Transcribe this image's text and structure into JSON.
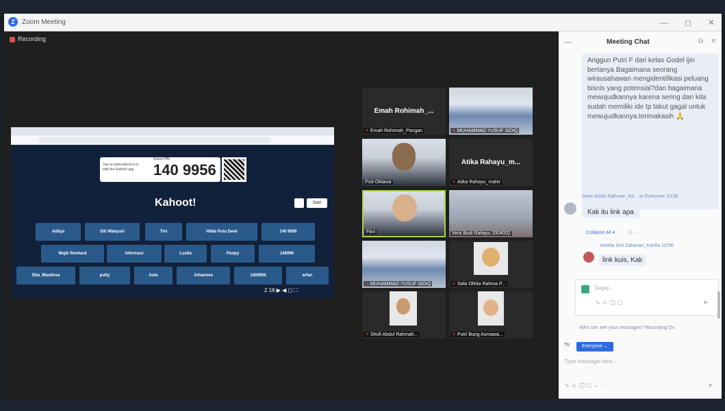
{
  "window": {
    "title": "Zoom Meeting",
    "controls": [
      "—",
      "◻",
      "✕"
    ]
  },
  "recording": {
    "label": "Recording"
  },
  "share": {
    "pin_hint": "Join at www.kahoot.it or with the Kahoot! app",
    "game_pin_label": "Game PIN:",
    "pin": "140 9956",
    "title": "Kahoot!",
    "start": "Start",
    "players": [
      "Aditya",
      "Siti Wahyuni",
      "Tini",
      "Hilda Putu Dewi",
      "140 9956",
      "Majik Renhard",
      "informasi",
      "Lusita",
      "Poopy",
      "140996",
      "Dita_Maulinsa",
      "putty",
      "Aulu",
      "Johannes",
      "1409956",
      "arfan"
    ],
    "controls": "2 16  ▶  ◀ ◻ ⛶"
  },
  "participants": [
    {
      "name": "Emah Rohimah_Pangan",
      "big": "Emah Rohimah_...",
      "type": "text"
    },
    {
      "name": "MUHAMMAD YUSUF SIDIQ",
      "type": "classroom"
    },
    {
      "name": "Fisti Oktavia",
      "type": "person"
    },
    {
      "name": "Atika Rahayu_mahir",
      "big": "Atika Rahayu_m...",
      "type": "text"
    },
    {
      "name": "Fikri",
      "type": "person-active"
    },
    {
      "name": "Vera Budi Rahayu 2004002",
      "type": "building"
    },
    {
      "name": "MUHAMMAD YUSUF SIDIQ",
      "type": "classroom"
    },
    {
      "name": "Safa Ofelia Rahma P...",
      "type": "avatar"
    },
    {
      "name": "Shofi Abdul Rahmah...",
      "type": "avatar"
    },
    {
      "name": "Putri Bung Asmawa...",
      "type": "avatar"
    }
  ],
  "chat": {
    "title": "Meeting Chat",
    "question": "Anggun Putri F dari kelas Godel ijin bertanya Bagaimana seorang wirausahawan mengidentifikasi peluang bisnis yang potensial?dan bagaimana mewujudkannya karena sering dari kita sudah memiliki ide tp takut gagal untuk mewujudkannya.terimakasih 🙏",
    "msg1_meta": "Dean Atsila Rahman_Ke... to Everyone  10:56",
    "msg1_text": "Kak itu link apa",
    "collapse": "Collapse All ▾",
    "reply_meta": "Amelia Dwi Zahanan_Kanfia  10:56",
    "reply_text": "link kuis, Kak",
    "reply_placeholder": "Reply...",
    "who_can_see": "Who can see your messages? Recording On",
    "to_label": "To:",
    "to_value": "Everyone ⌄",
    "type_placeholder": "Type message here..."
  }
}
